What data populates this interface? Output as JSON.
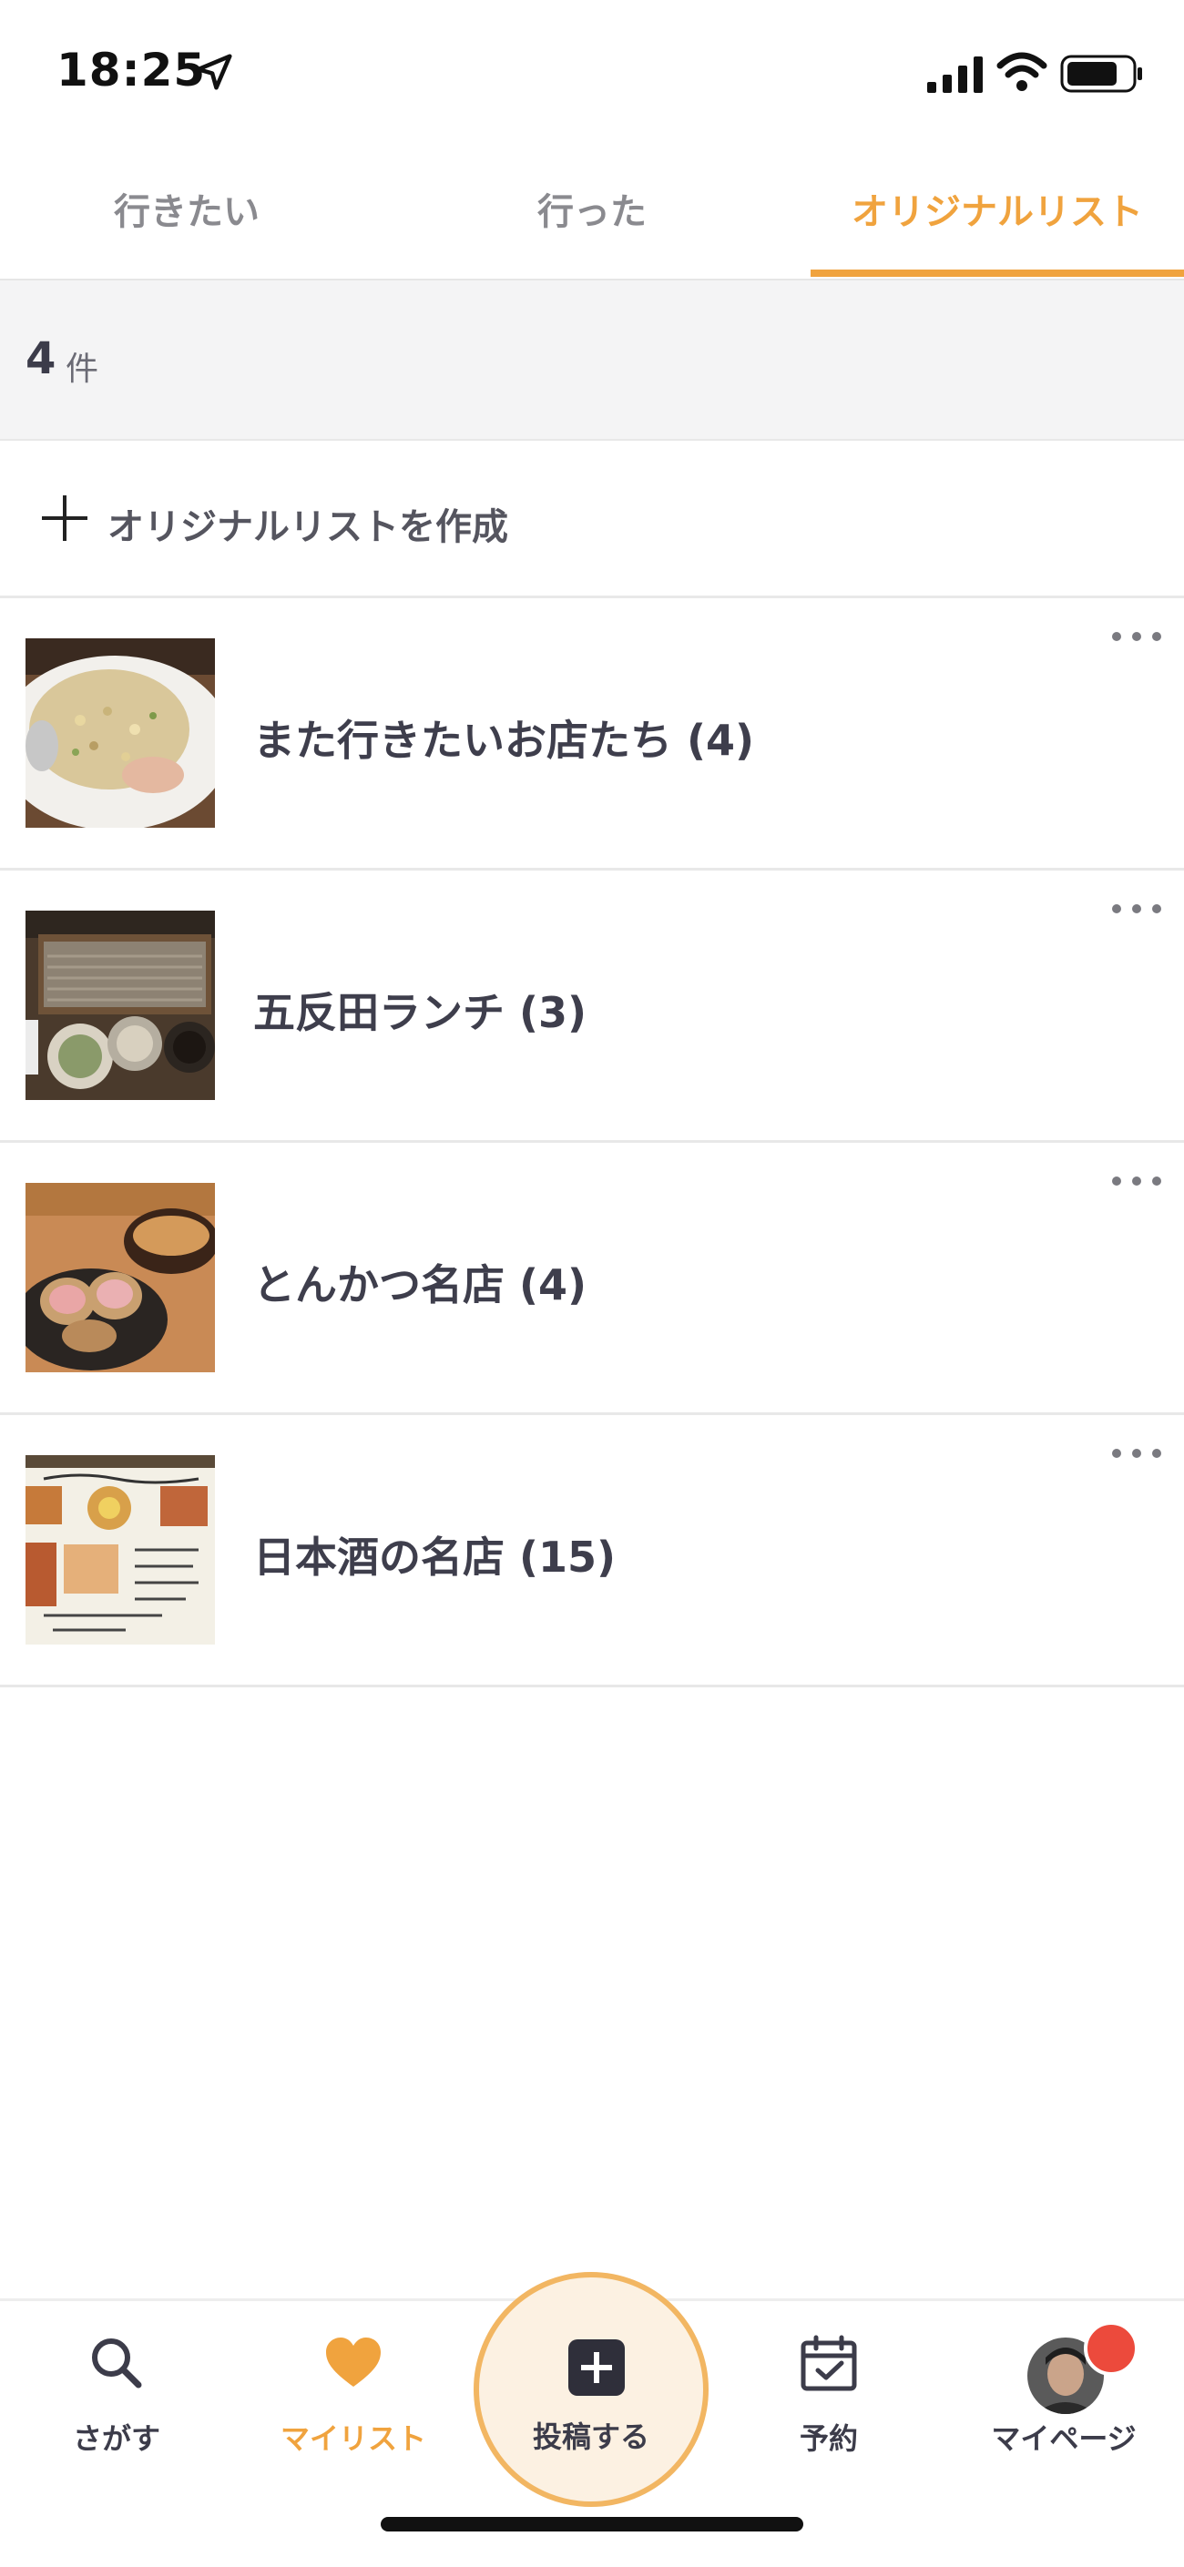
{
  "status_bar": {
    "time": "18:25"
  },
  "tabs": [
    {
      "label": "行きたい",
      "active": false
    },
    {
      "label": "行った",
      "active": false
    },
    {
      "label": "オリジナルリスト",
      "active": true
    }
  ],
  "count": {
    "number": "4",
    "unit": "件"
  },
  "create": {
    "label": "オリジナルリストを作成"
  },
  "lists": [
    {
      "title": "また行きたいお店たち (4)",
      "thumb_icon": "fried-rice-photo"
    },
    {
      "title": "五反田ランチ (3)",
      "thumb_icon": "soba-photo"
    },
    {
      "title": "とんかつ名店 (4)",
      "thumb_icon": "tonkatsu-photo"
    },
    {
      "title": "日本酒の名店 (15)",
      "thumb_icon": "menu-photo"
    }
  ],
  "bottom_nav": {
    "search": "さがす",
    "mylist": "マイリスト",
    "post": "投稿する",
    "reserve": "予約",
    "mypage": "マイページ"
  },
  "colors": {
    "accent": "#f0a33e",
    "text": "#3c3c4a",
    "badge": "#ec4a3c",
    "post_bg": "#fcf1e2"
  }
}
